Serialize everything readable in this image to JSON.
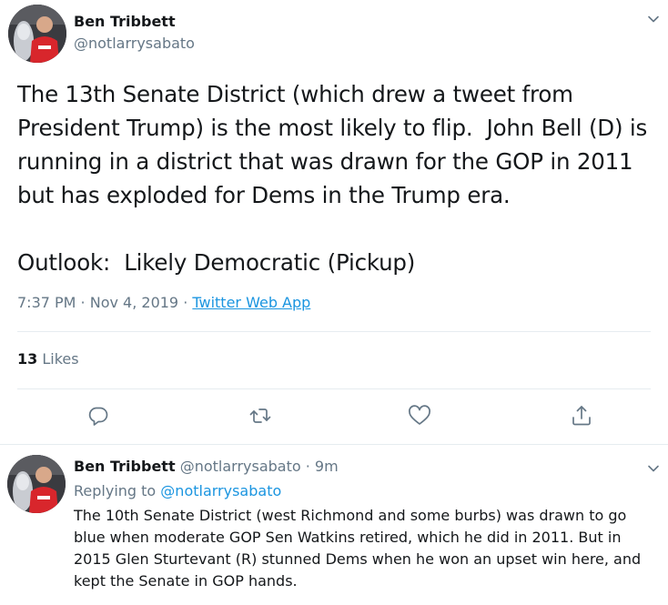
{
  "main_tweet": {
    "author_name": "Ben Tribbett",
    "author_handle": "@notlarrysabato",
    "text": "The 13th Senate District (which drew a tweet from President Trump) is the most likely to flip.  John Bell (D) is running in a district that was drawn for the GOP in 2011 but has exploded for Dems in the Trump era.\n\nOutlook:  Likely Democratic (Pickup)",
    "time": "7:37 PM · Nov 4, 2019 · ",
    "source": "Twitter Web App",
    "likes_count": "13",
    "likes_label": "Likes"
  },
  "actions": {
    "reply_icon": "reply-icon",
    "retweet_icon": "retweet-icon",
    "like_icon": "heart-icon",
    "share_icon": "share-icon"
  },
  "reply_tweet": {
    "author_name": "Ben Tribbett",
    "author_handle": "@notlarrysabato",
    "time_ago": "· 9m",
    "replying_prefix": "Replying to",
    "replying_handle": "@notlarrysabato",
    "text": "The 10th Senate District (west Richmond and some burbs) was drawn to go blue when moderate GOP Sen Watkins retired, which he did in 2011.  But in 2015 Glen Sturtevant (R) stunned Dems when he won an upset win here, and kept the Senate in GOP hands."
  },
  "colors": {
    "text_primary": "#14171a",
    "text_secondary": "#657786",
    "link": "#1b95e0",
    "divider": "#e6ecf0"
  }
}
